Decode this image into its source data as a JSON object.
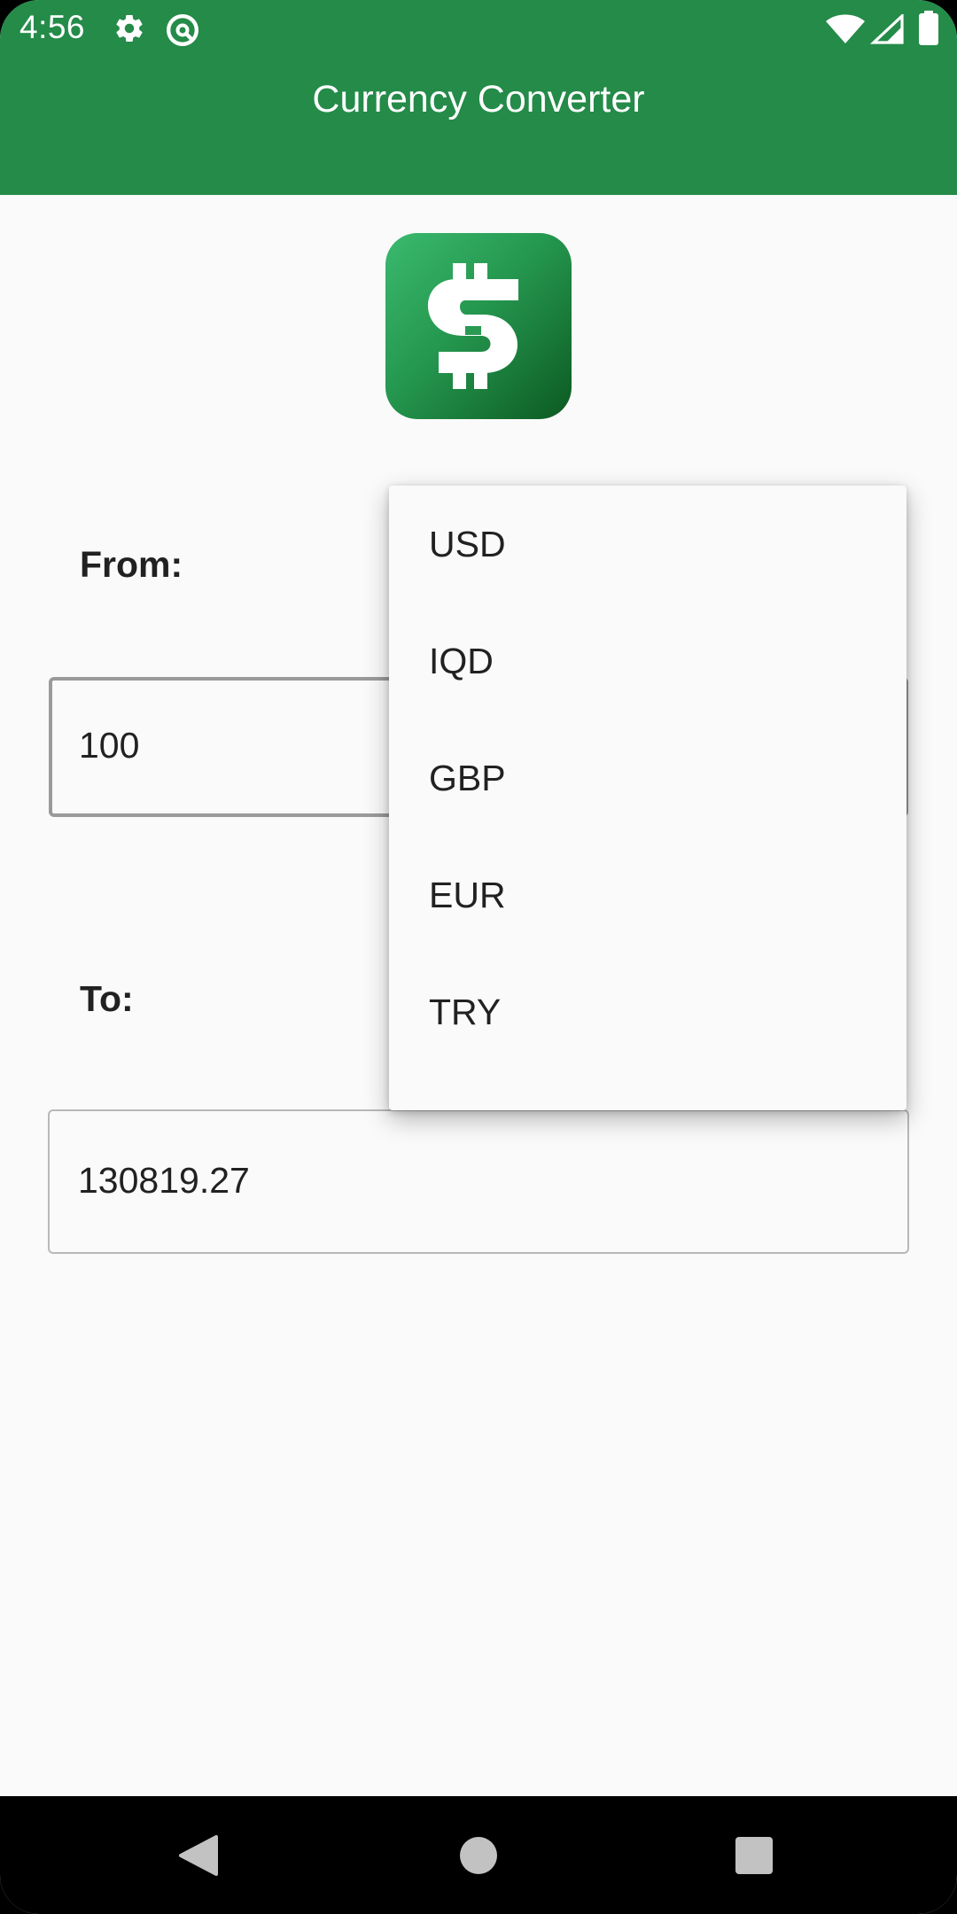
{
  "status_bar": {
    "time": "4:56",
    "icons": [
      "gear-icon",
      "at-sign-icon",
      "wifi-icon",
      "signal-icon",
      "battery-icon"
    ]
  },
  "app_bar": {
    "title": "Currency Converter",
    "color": "#248b49"
  },
  "logo": {
    "icon": "dollar-sign-logo-icon"
  },
  "from_section": {
    "label": "From:",
    "amount_value": "100"
  },
  "to_section": {
    "label": "To:",
    "result_value": "130819.27"
  },
  "currency_dropdown": {
    "options": [
      "USD",
      "IQD",
      "GBP",
      "EUR",
      "TRY"
    ]
  },
  "nav_bar": {
    "buttons": [
      "back-icon",
      "home-icon",
      "recents-icon"
    ]
  }
}
